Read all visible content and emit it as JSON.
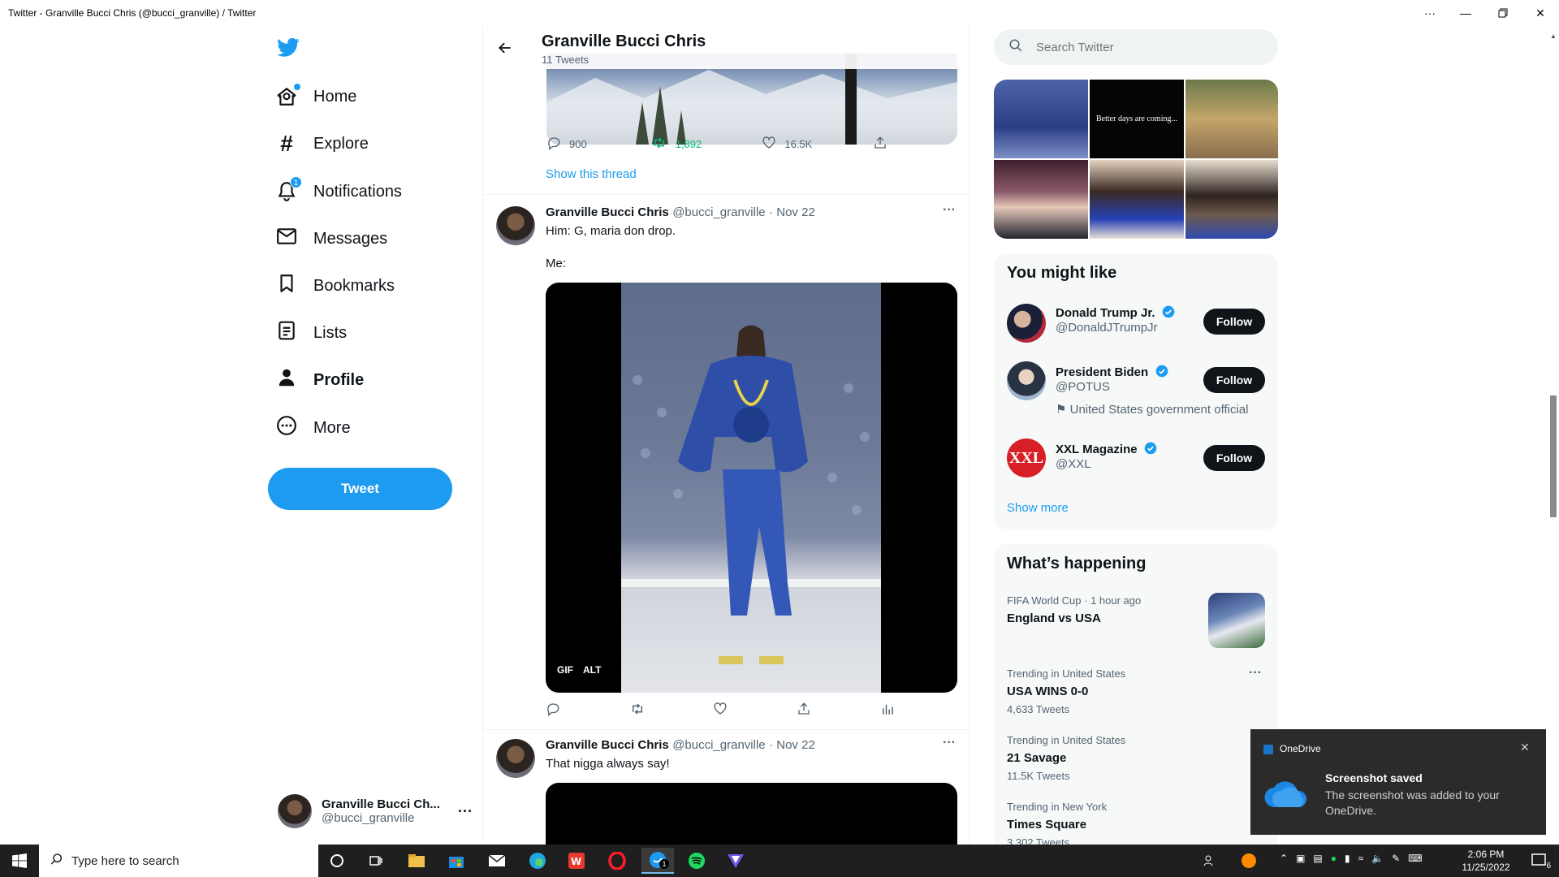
{
  "window": {
    "title": "Twitter - Granville Bucci Chris (@bucci_granville) / Twitter"
  },
  "nav": {
    "items": [
      {
        "label": "Home"
      },
      {
        "label": "Explore"
      },
      {
        "label": "Notifications",
        "badge": "1"
      },
      {
        "label": "Messages"
      },
      {
        "label": "Bookmarks"
      },
      {
        "label": "Lists"
      },
      {
        "label": "Profile"
      },
      {
        "label": "More"
      }
    ],
    "tweet_button": "Tweet"
  },
  "account": {
    "name": "Granville Bucci Ch...",
    "handle": "@bucci_granville"
  },
  "profile_header": {
    "name": "Granville Bucci Chris",
    "tweets_count": "11 Tweets"
  },
  "top_tweet_actions": {
    "replies": "900",
    "retweets": "1,892",
    "likes": "16.5K"
  },
  "show_thread": "Show this thread",
  "tweet1": {
    "name": "Granville Bucci Chris",
    "handle": "@bucci_granville",
    "date": "· Nov 22",
    "line1": "Him: G, maria don drop.",
    "line2": "Me:",
    "badge_gif": "GIF",
    "badge_alt": "ALT"
  },
  "tweet2": {
    "name": "Granville Bucci Chris",
    "handle": "@bucci_granville",
    "date": "· Nov 22",
    "text": "That nigga always say!"
  },
  "search": {
    "placeholder": "Search Twitter"
  },
  "media_grid": {
    "caption_tile": "Better days are coming..."
  },
  "you_might_like": {
    "title": "You might like",
    "users": [
      {
        "name": "Donald Trump Jr.",
        "handle": "@DonaldJTrumpJr",
        "button": "Follow"
      },
      {
        "name": "President Biden",
        "handle": "@POTUS",
        "button": "Follow",
        "label": "United States government official"
      },
      {
        "name": "XXL Magazine",
        "handle": "@XXL",
        "button": "Follow",
        "avatar_text": "XXL"
      }
    ],
    "show_more": "Show more"
  },
  "whats_happening": {
    "title": "What’s happening",
    "items": [
      {
        "meta": "FIFA World Cup · 1 hour ago",
        "name": "England vs USA"
      },
      {
        "meta": "Trending in United States",
        "name": "USA WINS 0-0",
        "count": "4,633 Tweets"
      },
      {
        "meta": "Trending in United States",
        "name": "21 Savage",
        "count": "11.5K Tweets"
      },
      {
        "meta": "Trending in New York",
        "name": "Times Square",
        "count": "3,302 Tweets"
      }
    ]
  },
  "toast": {
    "app": "OneDrive",
    "title": "Screenshot saved",
    "body": "The screenshot was added to your OneDrive."
  },
  "taskbar": {
    "search_placeholder": "Type here to search",
    "time": "2:06 PM",
    "date": "11/25/2022",
    "notif_count": "6",
    "twitter_badge": "1"
  },
  "colors": {
    "accent": "#1d9bf0",
    "retweet": "#00ba7c",
    "text": "#0f1419",
    "muted": "#536471"
  }
}
